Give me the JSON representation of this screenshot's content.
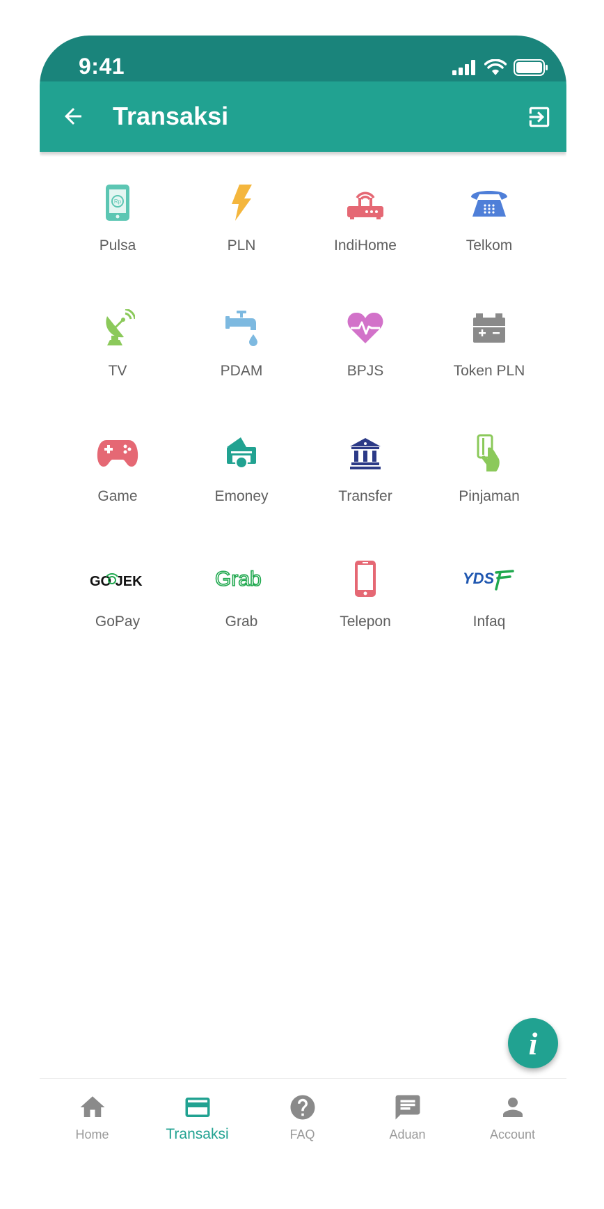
{
  "status": {
    "time": "9:41"
  },
  "appbar": {
    "title": "Transaksi"
  },
  "items": [
    {
      "label": "Pulsa",
      "icon": "phone-rp-icon",
      "color": "#5cc6b3"
    },
    {
      "label": "PLN",
      "icon": "lightning-icon",
      "color": "#f4b63d"
    },
    {
      "label": "IndiHome",
      "icon": "router-icon",
      "color": "#e56874"
    },
    {
      "label": "Telkom",
      "icon": "telephone-icon",
      "color": "#4f7fd8"
    },
    {
      "label": "TV",
      "icon": "satellite-dish-icon",
      "color": "#8bc95a"
    },
    {
      "label": "PDAM",
      "icon": "water-tap-icon",
      "color": "#7db9e0"
    },
    {
      "label": "BPJS",
      "icon": "heart-pulse-icon",
      "color": "#d272c9"
    },
    {
      "label": "Token PLN",
      "icon": "battery-icon",
      "color": "#8a8a8a"
    },
    {
      "label": "Game",
      "icon": "gamepad-icon",
      "color": "#e56874"
    },
    {
      "label": "Emoney",
      "icon": "wallet-card-icon",
      "color": "#21a291"
    },
    {
      "label": "Transfer",
      "icon": "bank-icon",
      "color": "#2c3a87"
    },
    {
      "label": "Pinjaman",
      "icon": "hand-card-icon",
      "color": "#8bc95a"
    },
    {
      "label": "GoPay",
      "icon": "gojek-logo",
      "logo_text": "GO  JEK",
      "color": "#111111"
    },
    {
      "label": "Grab",
      "icon": "grab-logo",
      "logo_text": "Grab",
      "color": "#1fa84e"
    },
    {
      "label": "Telepon",
      "icon": "mobile-phone-icon",
      "color": "#e56874"
    },
    {
      "label": "Infaq",
      "icon": "yds-logo",
      "logo_text": "YDS",
      "color": "#1f57b0"
    }
  ],
  "fab": {
    "label": "i"
  },
  "nav": [
    {
      "label": "Home",
      "icon": "home-icon",
      "active": false
    },
    {
      "label": "Transaksi",
      "icon": "card-icon",
      "active": true
    },
    {
      "label": "FAQ",
      "icon": "help-circle-icon",
      "active": false
    },
    {
      "label": "Aduan",
      "icon": "message-icon",
      "active": false
    },
    {
      "label": "Account",
      "icon": "person-icon",
      "active": false
    }
  ],
  "colors": {
    "primary": "#21a291",
    "primary_dark": "#1a847b",
    "nav_inactive": "#9a9a9a"
  }
}
